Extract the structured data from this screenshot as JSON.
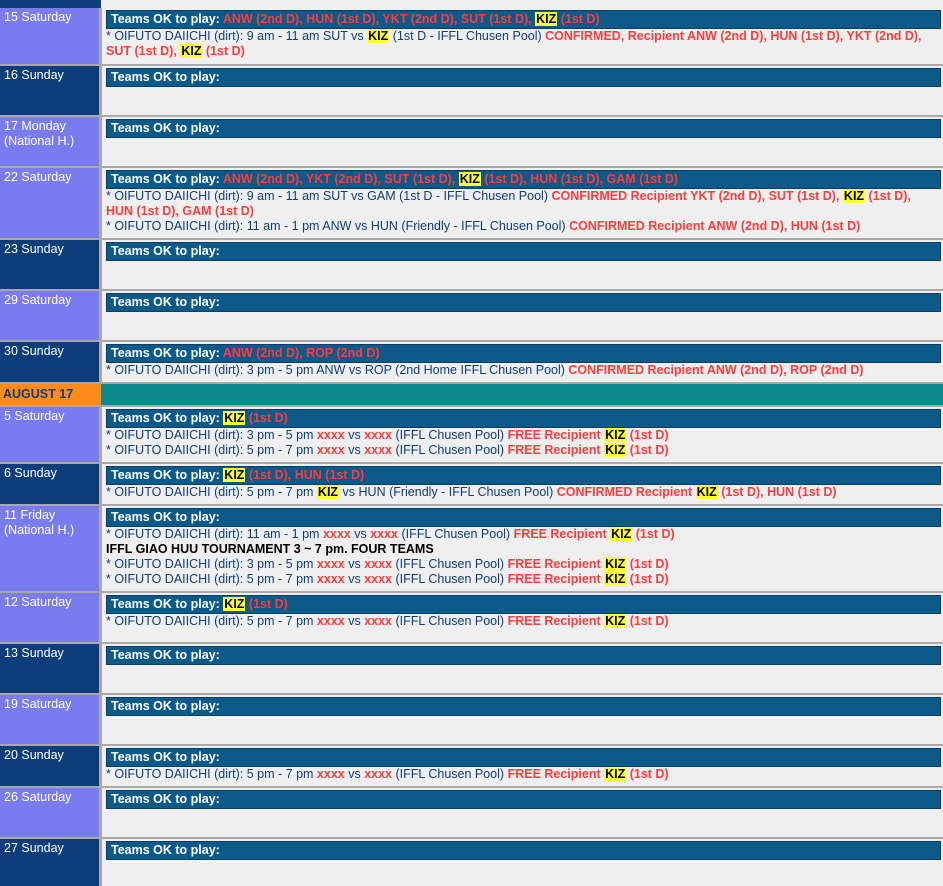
{
  "ok_label": "Teams OK to play:",
  "prefix": "* OIFUTO DAIICHI (dirt): ",
  "month": "AUGUST 17",
  "rows": [
    {
      "date": "15 Saturday",
      "ok": [
        [
          "r",
          "ANW (2nd D), HUN (1st D), YKT (2nd D), SUT (1st D), "
        ],
        [
          "k",
          "KIZ"
        ],
        [
          "r",
          " (1st D)"
        ]
      ],
      "lines": [
        [
          [
            "n",
            "* OIFUTO DAIICHI (dirt): 9 am - 11 am SUT vs "
          ],
          [
            "k",
            "KIZ"
          ],
          [
            "n",
            " (1st D - IFFL Chusen Pool) "
          ],
          [
            "r",
            "CONFIRMED, Recipient ANW (2nd D), HUN (1st D), YKT (2nd D), SUT (1st D), "
          ],
          [
            "k",
            "KIZ"
          ],
          [
            "r",
            " (1st D)"
          ]
        ]
      ]
    },
    {
      "date": "16 Sunday",
      "ok": [],
      "lines": []
    },
    {
      "date": "17 Monday (National H.)",
      "ok": [],
      "lines": []
    },
    {
      "date": "22 Saturday",
      "ok": [
        [
          "r",
          "ANW (2nd D), YKT (2nd D), SUT (1st D), "
        ],
        [
          "k",
          "KIZ"
        ],
        [
          "r",
          " (1st D), HUN (1st D), GAM (1st D)"
        ]
      ],
      "lines": [
        [
          [
            "n",
            "* OIFUTO DAIICHI (dirt): 9 am - 11 am SUT vs GAM (1st D - IFFL Chusen Pool) "
          ],
          [
            "r",
            "CONFIRMED Recipient YKT (2nd D), SUT (1st D), "
          ],
          [
            "k",
            "KIZ"
          ],
          [
            "r",
            " (1st D), HUN (1st D), GAM (1st D)"
          ]
        ],
        [
          [
            "n",
            "* OIFUTO DAIICHI (dirt): 11 am - 1 pm ANW vs HUN (Friendly - IFFL Chusen Pool) "
          ],
          [
            "r",
            "CONFIRMED Recipient ANW (2nd D), HUN (1st D)"
          ]
        ]
      ]
    },
    {
      "date": "23 Sunday",
      "ok": [],
      "lines": []
    },
    {
      "date": "29 Saturday",
      "ok": [],
      "lines": []
    },
    {
      "date": "30 Sunday",
      "ok": [
        [
          "r",
          " ANW (2nd D), ROP (2nd D)"
        ]
      ],
      "lines": [
        [
          [
            "n",
            "* OIFUTO DAIICHI (dirt): 3 pm - 5 pm ANW vs ROP (2nd Home IFFL Chusen Pool) "
          ],
          [
            "r",
            "CONFIRMED Recipient ANW (2nd D), ROP (2nd D)"
          ]
        ]
      ]
    },
    {
      "date": "5 Saturday",
      "ok": [
        [
          "k",
          "KIZ"
        ],
        [
          "r",
          " (1st D)"
        ]
      ],
      "lines": [
        [
          [
            "n",
            "* OIFUTO DAIICHI (dirt): 3 pm - 5 pm "
          ],
          [
            "r",
            "xxxx"
          ],
          [
            "n",
            " vs "
          ],
          [
            "r",
            "xxxx"
          ],
          [
            "n",
            " (IFFL Chusen Pool) "
          ],
          [
            "r",
            "FREE Recipient "
          ],
          [
            "k",
            "KIZ"
          ],
          [
            "r",
            " (1st D)"
          ]
        ],
        [
          [
            "n",
            "* OIFUTO DAIICHI (dirt): 5 pm - 7 pm "
          ],
          [
            "r",
            "xxxx"
          ],
          [
            "n",
            " vs "
          ],
          [
            "r",
            "xxxx"
          ],
          [
            "n",
            " (IFFL Chusen Pool) "
          ],
          [
            "r",
            "FREE Recipient "
          ],
          [
            "k",
            "KIZ"
          ],
          [
            "r",
            " (1st D)"
          ]
        ]
      ]
    },
    {
      "date": "6 Sunday",
      "ok": [
        [
          "k",
          "KIZ"
        ],
        [
          "r",
          " (1st D), HUN (1st D)"
        ]
      ],
      "lines": [
        [
          [
            "n",
            "* OIFUTO DAIICHI (dirt): 5 pm - 7 pm "
          ],
          [
            "k",
            "KIZ"
          ],
          [
            "n",
            " vs HUN (Friendly - IFFL Chusen Pool) "
          ],
          [
            "r",
            "CONFIRMED Recipient "
          ],
          [
            "k",
            "KIZ"
          ],
          [
            "r",
            " (1st D), HUN (1st D)"
          ]
        ]
      ]
    },
    {
      "date": "11 Friday (National H.)",
      "ok": [],
      "lines": [
        [
          [
            "n",
            "* OIFUTO DAIICHI (dirt): 11 am - 1 pm "
          ],
          [
            "r",
            "xxxx"
          ],
          [
            "n",
            " vs "
          ],
          [
            "r",
            "xxxx"
          ],
          [
            "n",
            " (IFFL Chusen Pool) "
          ],
          [
            "r",
            "FREE Recipient "
          ],
          [
            "k",
            "KIZ"
          ],
          [
            "r",
            " (1st D)"
          ]
        ],
        [
          [
            "b",
            "IFFL GIAO HUU TOURNAMENT 3 ~ 7 pm. FOUR TEAMS"
          ]
        ],
        [
          [
            "n",
            "* OIFUTO DAIICHI (dirt): 3 pm - 5 pm "
          ],
          [
            "r",
            "xxxx"
          ],
          [
            "n",
            " vs "
          ],
          [
            "r",
            "xxxx"
          ],
          [
            "n",
            " (IFFL Chusen Pool) "
          ],
          [
            "r",
            "FREE Recipient "
          ],
          [
            "k",
            "KIZ"
          ],
          [
            "r",
            " (1st D)"
          ]
        ],
        [
          [
            "n",
            "* OIFUTO DAIICHI (dirt): 5 pm - 7 pm "
          ],
          [
            "r",
            "xxxx"
          ],
          [
            "n",
            " vs "
          ],
          [
            "r",
            "xxxx"
          ],
          [
            "n",
            " (IFFL Chusen Pool) "
          ],
          [
            "r",
            "FREE Recipient "
          ],
          [
            "k",
            "KIZ"
          ],
          [
            "r",
            " (1st D)"
          ]
        ]
      ]
    },
    {
      "date": "12 Saturday",
      "ok": [
        [
          "k",
          "KIZ"
        ],
        [
          "r",
          " (1st D)"
        ]
      ],
      "lines": [
        [
          [
            "n",
            "* OIFUTO DAIICHI (dirt): 5 pm - 7 pm "
          ],
          [
            "r",
            "xxxx"
          ],
          [
            "n",
            " vs "
          ],
          [
            "r",
            "xxxx"
          ],
          [
            "n",
            " (IFFL Chusen Pool) "
          ],
          [
            "r",
            "FREE Recipient "
          ],
          [
            "k",
            "KIZ"
          ],
          [
            "r",
            " (1st D)"
          ]
        ]
      ]
    },
    {
      "date": "13 Sunday",
      "ok": [],
      "lines": []
    },
    {
      "date": "19 Saturday",
      "ok": [],
      "lines": []
    },
    {
      "date": "20 Sunday",
      "ok": [],
      "lines": [
        [
          [
            "n",
            "* OIFUTO DAIICHI (dirt): 5 pm - 7 pm "
          ],
          [
            "r",
            "xxxx"
          ],
          [
            "n",
            " vs "
          ],
          [
            "r",
            "xxxx"
          ],
          [
            "n",
            " (IFFL Chusen Pool) "
          ],
          [
            "r",
            "FREE Recipient "
          ],
          [
            "k",
            "KIZ"
          ],
          [
            "r",
            " (1st D)"
          ]
        ]
      ]
    },
    {
      "date": "26 Saturday",
      "ok": [],
      "lines": []
    },
    {
      "date": "27 Sunday",
      "ok": [],
      "lines": []
    }
  ]
}
